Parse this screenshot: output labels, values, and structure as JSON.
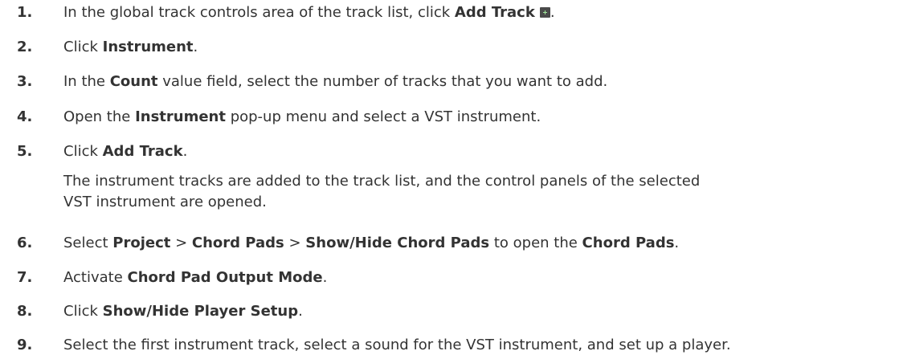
{
  "steps": [
    {
      "num": "1.",
      "parts": [
        "In the global track controls area of the track list, click ",
        "Add Track",
        "."
      ],
      "icon": "add-track-icon"
    },
    {
      "num": "2.",
      "parts": [
        "Click ",
        "Instrument",
        "."
      ]
    },
    {
      "num": "3.",
      "parts": [
        "In the ",
        "Count",
        " value field, select the number of tracks that you want to add."
      ]
    },
    {
      "num": "4.",
      "parts": [
        "Open the ",
        "Instrument",
        " pop-up menu and select a VST instrument."
      ]
    },
    {
      "num": "5.",
      "parts": [
        "Click ",
        "Add Track",
        "."
      ],
      "result": "The instrument tracks are added to the track list, and the control panels of the selected VST instrument are opened."
    },
    {
      "num": "6.",
      "parts": [
        "Select ",
        "Project",
        " > ",
        "Chord Pads",
        " > ",
        "Show/Hide Chord Pads",
        " to open the ",
        "Chord Pads",
        "."
      ]
    },
    {
      "num": "7.",
      "parts": [
        "Activate ",
        "Chord Pad Output Mode",
        "."
      ]
    },
    {
      "num": "8.",
      "parts": [
        "Click ",
        "Show/Hide Player Setup",
        "."
      ]
    },
    {
      "num": "9.",
      "parts": [
        "Select the first instrument track, select a sound for the VST instrument, and set up a player."
      ]
    }
  ]
}
